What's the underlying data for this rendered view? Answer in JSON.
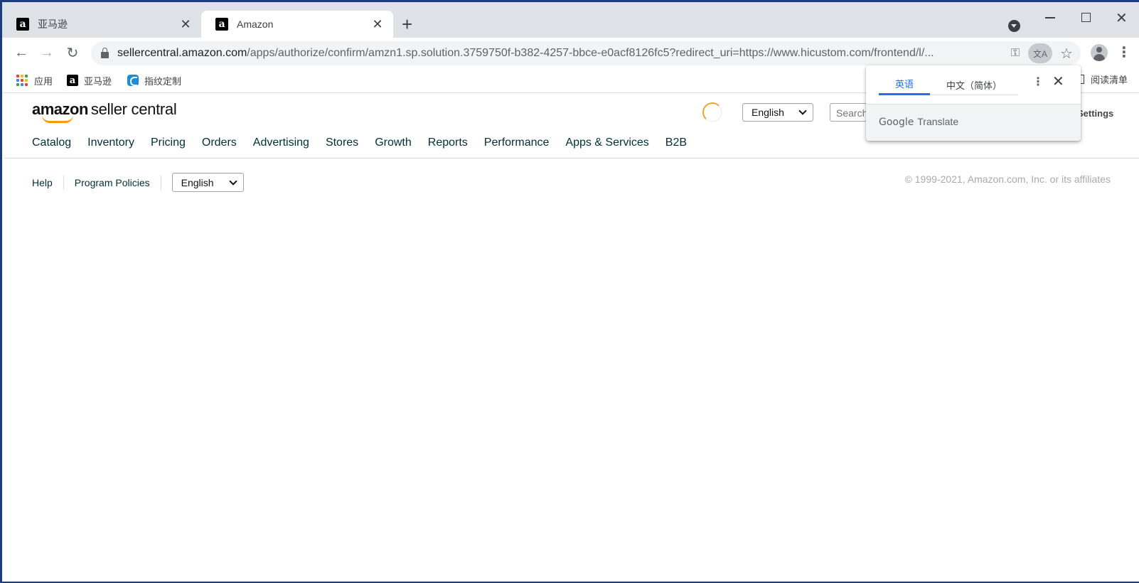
{
  "browser": {
    "tabs": [
      {
        "title": "亚马逊",
        "active": false
      },
      {
        "title": "Amazon",
        "active": true
      }
    ],
    "url_host": "sellercentral.amazon.com",
    "url_path": "/apps/authorize/confirm/amzn1.sp.solution.3759750f-b382-4257-bbce-e0acf8126fc5?redirect_uri=https://www.hicustom.com/frontend/l/...",
    "bookmarks": [
      {
        "label": "应用",
        "icon": "apps-grid-icon"
      },
      {
        "label": "亚马逊",
        "icon": "amazon-icon"
      },
      {
        "label": "指纹定制",
        "icon": "fingerprint-icon"
      }
    ],
    "reading_list": "阅读清单",
    "favicon_letter": "a"
  },
  "translate_popup": {
    "tabs": [
      "英语",
      "中文（简体）"
    ],
    "brand_google": "Google",
    "brand_translate": "Translate"
  },
  "seller_central": {
    "logo_word": "amazon",
    "logo_rest": "seller central",
    "top_language": "English",
    "search_placeholder": "Search",
    "settings": "Settings",
    "nav": [
      "Catalog",
      "Inventory",
      "Pricing",
      "Orders",
      "Advertising",
      "Stores",
      "Growth",
      "Reports",
      "Performance",
      "Apps & Services",
      "B2B"
    ],
    "footer": {
      "help": "Help",
      "program_policies": "Program Policies",
      "language": "English",
      "copyright": "© 1999-2021, Amazon.com, Inc. or its affiliates"
    }
  },
  "colors": {
    "accent_blue": "#1a73e8",
    "amazon_orange": "#ff9900",
    "nav_text": "#002f36"
  }
}
